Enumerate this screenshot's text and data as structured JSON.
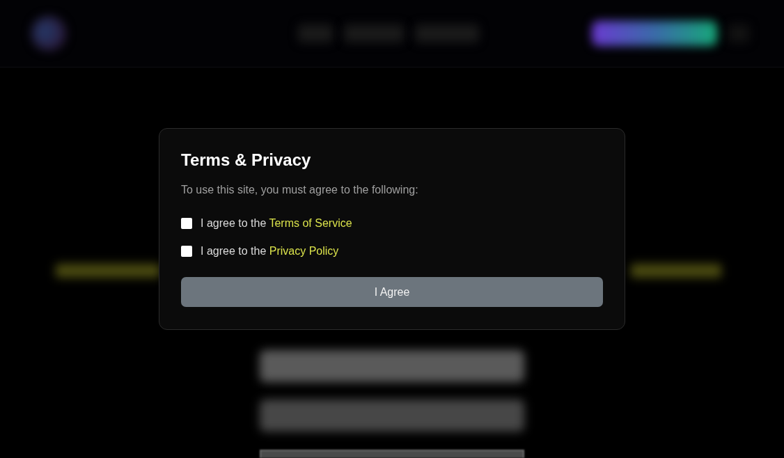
{
  "dialog": {
    "title": "Terms & Privacy",
    "intro": "To use this site, you must agree to the following:",
    "agreements": [
      {
        "text": "I agree to the ",
        "link": "Terms of Service",
        "checked": false
      },
      {
        "text": "I agree to the ",
        "link": "Privacy Policy",
        "checked": false
      }
    ],
    "button": "I Agree"
  }
}
